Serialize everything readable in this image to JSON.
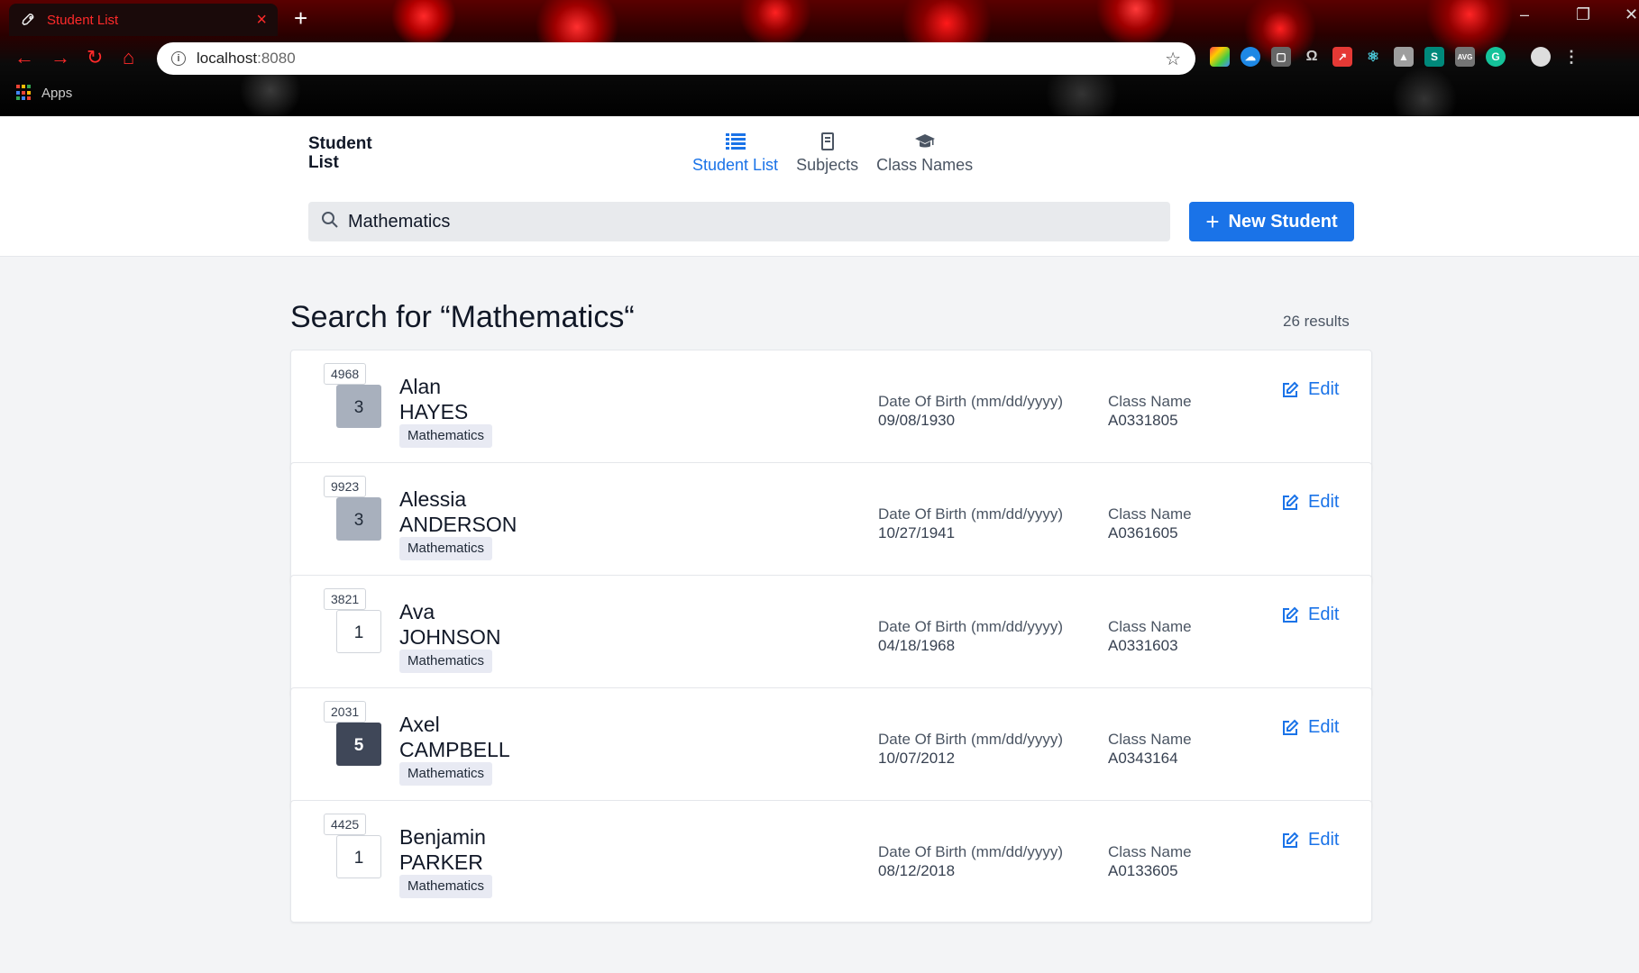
{
  "browser": {
    "tab_title": "Student List",
    "new_tab_symbol": "+",
    "url_host": "localhost",
    "url_port": ":8080",
    "bookmarks_label": "Apps"
  },
  "header": {
    "brand_line1": "Student",
    "brand_line2": "List",
    "nav": [
      {
        "label": "Student List",
        "icon": "list-icon",
        "active": true
      },
      {
        "label": "Subjects",
        "icon": "book-icon",
        "active": false
      },
      {
        "label": "Class Names",
        "icon": "graduation-cap-icon",
        "active": false
      }
    ],
    "search_value": "Mathematics",
    "new_student_label": "New Student"
  },
  "results": {
    "title": "Search for “Mathematics“",
    "count": "26 results"
  },
  "labels": {
    "dob": "Date Of Birth (mm/dd/yyyy)",
    "class_name": "Class Name",
    "edit": "Edit"
  },
  "students": [
    {
      "id": "4968",
      "level": "3",
      "first": "Alan",
      "last": "HAYES",
      "subject": "Mathematics",
      "dob": "09/08/1930",
      "class_name": "A0331805"
    },
    {
      "id": "9923",
      "level": "3",
      "first": "Alessia",
      "last": "ANDERSON",
      "subject": "Mathematics",
      "dob": "10/27/1941",
      "class_name": "A0361605"
    },
    {
      "id": "3821",
      "level": "1",
      "first": "Ava",
      "last": "JOHNSON",
      "subject": "Mathematics",
      "dob": "04/18/1968",
      "class_name": "A0331603"
    },
    {
      "id": "2031",
      "level": "5",
      "first": "Axel",
      "last": "CAMPBELL",
      "subject": "Mathematics",
      "dob": "10/07/2012",
      "class_name": "A0343164"
    },
    {
      "id": "4425",
      "level": "1",
      "first": "Benjamin",
      "last": "PARKER",
      "subject": "Mathematics",
      "dob": "08/12/2018",
      "class_name": "A0133605"
    }
  ],
  "colors": {
    "accent": "#1a73e8",
    "level_1": "#ffffff",
    "level_3": "#a8b0bd",
    "level_5": "#3f4758"
  }
}
